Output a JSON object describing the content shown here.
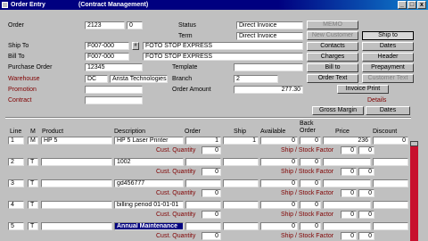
{
  "window": {
    "title": "Order Entry",
    "subtitle": "(Contract Management)",
    "min": "_",
    "max": "□",
    "close": "x"
  },
  "header": {
    "order_label": "Order",
    "order_value": "2123",
    "order_suffix": "0",
    "status_label": "Status",
    "status_value": "Direct Invoice",
    "term_label": "Term",
    "term_value": "Direct Invoice",
    "ship_to_label": "Ship To",
    "ship_to_code": "F007-000",
    "ship_to_name": "FOTO STOP EXPRESS",
    "bill_to_label": "Bill To",
    "bill_to_code": "F007-000",
    "bill_to_name": "FOTO STOP EXPRESS",
    "po_label": "Purchase Order",
    "po_value": "12345",
    "template_label": "Template",
    "template_value": "",
    "warehouse_label": "Warehouse",
    "warehouse_code": "DC",
    "warehouse_name": "Arista Technologies",
    "branch_label": "Branch",
    "branch_value": "2",
    "promotion_label": "Promotion",
    "promotion_value": "",
    "order_amount_label": "Order Amount",
    "order_amount_value": "277.30",
    "contract_label": "Contract",
    "contract_value": "",
    "details_label": "Details"
  },
  "buttons": {
    "top1": "MEMO",
    "top2": "New Customer",
    "top3": "Ship to",
    "contacts": "Contacts",
    "dates": "Dates",
    "charges": "Charges",
    "header": "Header",
    "bill_to": "Bill to",
    "prepayment": "Prepayment",
    "order_text": "Order Text",
    "customer_text": "Customer Text",
    "invoice_print": "Invoice Print",
    "gross_margin": "Gross Margin",
    "dates2": "Dates"
  },
  "columns": {
    "line": "Line",
    "m": "M",
    "product": "Product",
    "description": "Description",
    "order": "Order",
    "ship": "Ship",
    "available": "Available",
    "back_order": "Back Order",
    "price": "Price",
    "discount": "Discount"
  },
  "subrow": {
    "cust_quantity": "Cust. Quantity",
    "ship_stock_factor": "Ship / Stock Factor"
  },
  "lines": [
    {
      "line": "1",
      "m": "M",
      "product": "HP 5",
      "description": "HP 5 Laser Printer",
      "order": "1",
      "ship": "1",
      "available": "0",
      "back_order": "0",
      "price": "236",
      "discount": "0",
      "cust_qty": "0",
      "sub_ship": "0",
      "sub_factor": "0"
    },
    {
      "line": "2",
      "m": "T",
      "product": "",
      "description": "1002",
      "order": "",
      "ship": "",
      "available": "0",
      "back_order": "0",
      "price": "",
      "discount": "",
      "cust_qty": "0",
      "sub_ship": "0",
      "sub_factor": "0"
    },
    {
      "line": "3",
      "m": "T",
      "product": "",
      "description": "gd456777",
      "order": "",
      "ship": "",
      "available": "0",
      "back_order": "0",
      "price": "",
      "discount": "",
      "cust_qty": "0",
      "sub_ship": "0",
      "sub_factor": "0"
    },
    {
      "line": "4",
      "m": "T",
      "product": "",
      "description": "billing period   01-01-01",
      "order": "",
      "ship": "",
      "available": "0",
      "back_order": "0",
      "price": "",
      "discount": "",
      "cust_qty": "0",
      "sub_ship": "0",
      "sub_factor": "0"
    },
    {
      "line": "5",
      "m": "T",
      "product": "",
      "description": "Annual Maintenance",
      "order": "",
      "ship": "",
      "available": "0",
      "back_order": "0",
      "price": "",
      "discount": "",
      "cust_qty": "0",
      "sub_ship": "0",
      "sub_factor": "0"
    }
  ],
  "misc": {
    "lookup_glyph": "#",
    "dash": "_"
  }
}
